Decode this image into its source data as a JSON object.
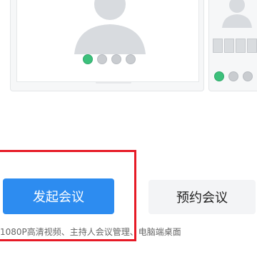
{
  "meeting_actions": {
    "start_label": "发起会议",
    "schedule_label": "预约会议"
  },
  "features_text": "1080P高清视频、主持人会议管理、电脑端桌面",
  "colors": {
    "primary": "#2d8cf0",
    "highlight": "#e61a26",
    "accent_green": "#3cc07b"
  }
}
